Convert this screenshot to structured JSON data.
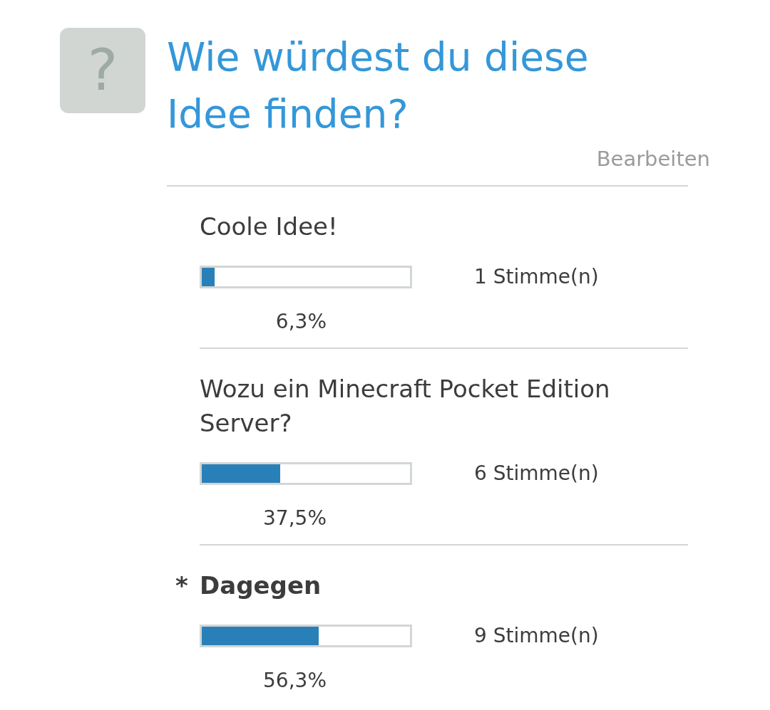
{
  "poll": {
    "icon": "?",
    "title": "Wie würdest du diese Idee finden?",
    "edit_link": "Bearbeiten",
    "selected_marker": "*",
    "options": [
      {
        "label": "Coole Idee!",
        "level": 0.063,
        "votes": "1 Stimme(n)",
        "percent": "6,3%",
        "selected": false
      },
      {
        "label": "Wozu ein Minecraft Pocket Edition Server?",
        "level": 0.375,
        "votes": "6 Stimme(n)",
        "percent": "37,5%",
        "selected": false
      },
      {
        "label": "Dagegen",
        "level": 0.563,
        "votes": "9 Stimme(n)",
        "percent": "56,3%",
        "selected": true
      }
    ]
  }
}
